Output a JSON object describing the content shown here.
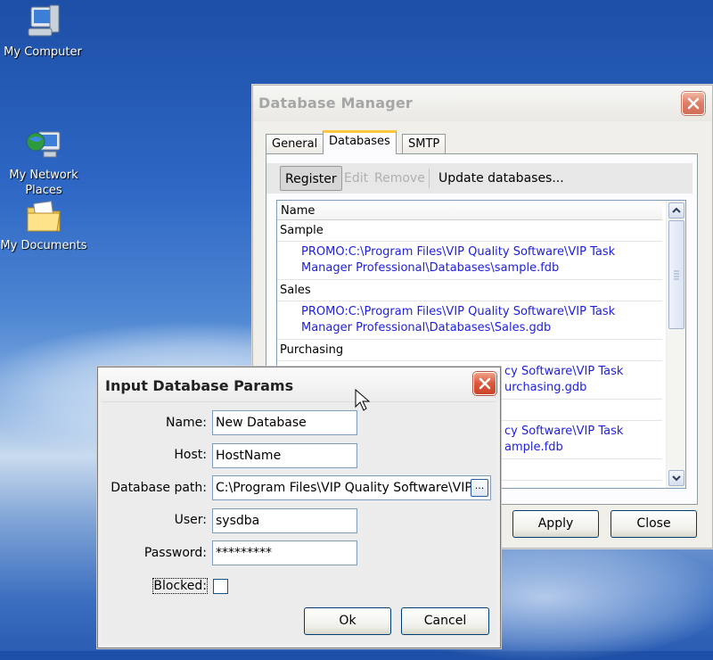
{
  "desktop": {
    "icons": [
      {
        "label": "My Computer",
        "icon": "computer-icon"
      },
      {
        "label": "My Network\nPlaces",
        "icon": "network-places-icon"
      },
      {
        "label": "My Documents",
        "icon": "documents-folder-icon"
      }
    ]
  },
  "db_manager": {
    "title": "Database Manager",
    "tabs": [
      {
        "label": "General"
      },
      {
        "label": "Databases",
        "active": true
      },
      {
        "label": "SMTP"
      }
    ],
    "toolbar": {
      "register": "Register",
      "edit": "Edit",
      "remove": "Remove",
      "update": "Update databases..."
    },
    "list": {
      "header": "Name",
      "groups": [
        {
          "name": "Sample",
          "path": "PROMO:C:\\Program Files\\VIP Quality Software\\VIP Task\nManager Professional\\Databases\\sample.fdb"
        },
        {
          "name": "Sales",
          "path": "PROMO:C:\\Program Files\\VIP Quality Software\\VIP Task\nManager Professional\\Databases\\Sales.gdb"
        },
        {
          "name": "Purchasing",
          "path": "cy Software\\VIP Task\nurchasing.gdb"
        },
        {
          "name": "",
          "path": "cy Software\\VIP Task\nample.fdb"
        }
      ]
    },
    "buttons": {
      "apply": "Apply",
      "close": "Close"
    }
  },
  "input_dialog": {
    "title": "Input Database Params",
    "fields": {
      "name": {
        "label": "Name:",
        "value": "New Database"
      },
      "host": {
        "label": "Host:",
        "value": "HostName"
      },
      "path": {
        "label": "Database path:",
        "value": "C:\\Program Files\\VIP Quality Software\\VIP T"
      },
      "user": {
        "label": "User:",
        "value": "sysdba"
      },
      "password": {
        "label": "Password:",
        "value": "*********"
      },
      "blocked": {
        "label": "Blocked:",
        "checked": false
      }
    },
    "browse_label": "...",
    "buttons": {
      "ok": "Ok",
      "cancel": "Cancel"
    }
  }
}
